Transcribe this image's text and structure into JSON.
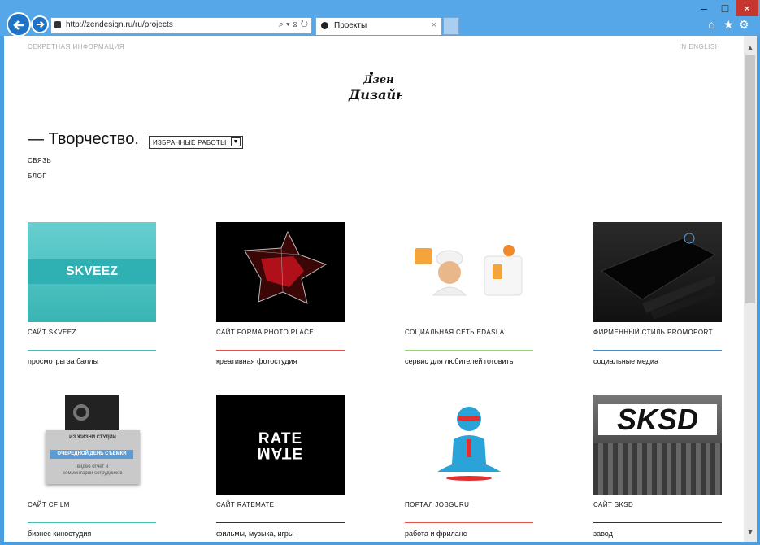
{
  "browser": {
    "address_url": "http://zendesign.ru/ru/projects",
    "tab_title": "Проекты",
    "tab_close": "×",
    "window_controls": [
      "–",
      "□",
      "×"
    ]
  },
  "page": {
    "top_left_link": "СЕКРЕТНАЯ ИНФОРМАЦИЯ",
    "top_right_link": "IN ENGLISH",
    "logo_text_top": "Дзен",
    "logo_text_bottom": "Дизайн",
    "heading": "— Творчество.",
    "dropdown_value": "ИЗБРАННЫЕ РАБОТЫ",
    "nav": [
      "СВЯЗЬ",
      "БЛОГ"
    ]
  },
  "projects": [
    {
      "title": "САЙТ SKVEEZ",
      "desc": "просмотры за баллы",
      "line_color": "#4bbcb8",
      "thumb_text": "SKVEEZ"
    },
    {
      "title": "САЙТ FORMA PHOTO PLACE",
      "desc": "креативная фотостудия",
      "line_color": "#e0504a",
      "thumb_text": ""
    },
    {
      "title": "СОЦИАЛЬНАЯ СЕТЬ EDASLA",
      "desc": "сервис для любителей готовить",
      "line_color": "#9ad07a",
      "thumb_text": ""
    },
    {
      "title": "ФИРМЕННЫЙ СТИЛЬ PROMOPORT",
      "desc": "социальные медиа",
      "line_color": "#4a8fc8",
      "thumb_text": ""
    },
    {
      "title": "САЙТ CFILM",
      "desc": "бизнес киностудия",
      "line_color": "#4bbcb8",
      "thumb_text": "",
      "overlay": {
        "header": "ИЗ ЖИЗНИ СТУДИИ",
        "button": "ОЧЕРЕДНОЙ ДЕНЬ СЪЕМКИ",
        "sub1": "видео отчет и",
        "sub2": "комментарии сотрудников"
      }
    },
    {
      "title": "САЙТ RATEMATE",
      "desc": "фильмы, музыка, игры",
      "line_color": "#333333",
      "thumb_text": "RATE"
    },
    {
      "title": "ПОРТАЛ JOBGURU",
      "desc": "работа и фриланс",
      "line_color": "#e0504a",
      "thumb_text": ""
    },
    {
      "title": "САЙТ SKSD",
      "desc": "завод",
      "line_color": "#333333",
      "thumb_text": "SKSD"
    }
  ]
}
